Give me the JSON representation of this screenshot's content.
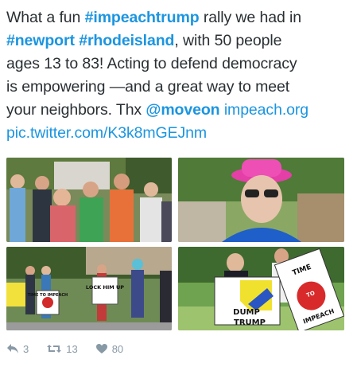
{
  "tweet": {
    "line1": {
      "a": "What a fun ",
      "tag1": "#impeachtrump",
      "b": " rally we had in"
    },
    "line2": {
      "tag2": "#newport",
      "sp": " ",
      "tag3": "#rhodeisland",
      "c": ", with 50 people"
    },
    "line3": "ages 13 to 83! Acting to defend democracy",
    "line4": "is empowering —and a great way to meet",
    "line5": {
      "a": "your neighbors. Thx ",
      "mention": "@moveon",
      "sp": " ",
      "url": "impeach.org"
    },
    "line6": "pic.twitter.com/K3k8mGEJnm"
  },
  "photos": {
    "sign_lock_him_up": "LOCK HIM UP",
    "sign_time_to_impeach_1": "TIME TO IMPEACH",
    "sign_dump_trump": "DUMP TRUMP",
    "sign_time_to_impeach_2": "TIME TO IMPEACH"
  },
  "actions": {
    "reply_count": "3",
    "retweet_count": "13",
    "like_count": "80"
  },
  "colors": {
    "link": "#1b95e0",
    "text": "#292f33",
    "action": "#8899a6"
  },
  "icons": [
    "reply-icon",
    "retweet-icon",
    "heart-icon"
  ]
}
